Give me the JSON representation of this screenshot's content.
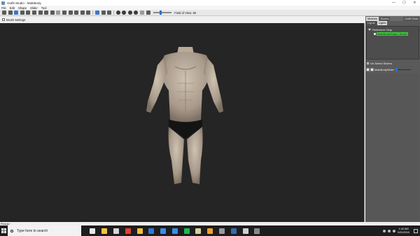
{
  "window": {
    "title": "Outfit Studio - MaleBody"
  },
  "window_controls": {
    "minimize": "—",
    "maximize": "☐",
    "close": "✕"
  },
  "menubar": [
    "File",
    "Edit",
    "Shape",
    "Slider",
    "Tool"
  ],
  "toolbar": {
    "fov_label": "Field of View: 65"
  },
  "brush_settings": {
    "label": "Brush Settings"
  },
  "right_panel": {
    "tabs": [
      "Meshes",
      "Bones",
      "Outfit Data"
    ],
    "active_tab": "Meshes",
    "subtabs": [
      "Lights",
      "Lights"
    ],
    "tree": {
      "root": "Reference Only",
      "shape": "MaleBodyShape_Body1"
    },
    "sliders_header": "Un-Select Sliders",
    "slider": {
      "label": "MaleBodySlider",
      "value": 0
    }
  },
  "status": {
    "text": "Ready!"
  },
  "taskbar": {
    "search_placeholder": "Type here to search",
    "time": "1:42 AM",
    "date": "9/20/2019",
    "apps": [
      {
        "name": "task-view-icon",
        "color": "#e8e8e8"
      },
      {
        "name": "file-explorer-icon",
        "color": "#f5c542"
      },
      {
        "name": "photos-icon",
        "color": "#d6d6d6"
      },
      {
        "name": "chrome-icon",
        "color": "#e34133"
      },
      {
        "name": "file-manager-icon",
        "color": "#f0c040"
      },
      {
        "name": "edge-icon",
        "color": "#2b79d8"
      },
      {
        "name": "store-icon",
        "color": "#3a8ee6"
      },
      {
        "name": "mail-icon",
        "color": "#3a8ee6"
      },
      {
        "name": "spotify-icon",
        "color": "#1db954"
      },
      {
        "name": "game-icon",
        "color": "#d9cfa0"
      },
      {
        "name": "nexus-icon",
        "color": "#f0a030"
      },
      {
        "name": "controller-icon",
        "color": "#9a9a9a"
      },
      {
        "name": "steam-icon",
        "color": "#3a6aa8"
      },
      {
        "name": "tablet-icon",
        "color": "#d0d0d0"
      },
      {
        "name": "outfit-studio-icon",
        "color": "#888888"
      }
    ]
  },
  "colors": {
    "viewport_bg": "#252525",
    "panel_bg": "#5a5a5a",
    "shape_highlight": "#3fc43f",
    "accent": "#2a6ed6"
  }
}
